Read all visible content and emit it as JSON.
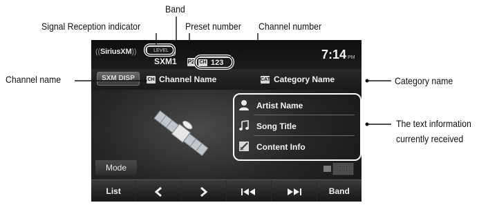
{
  "callouts": {
    "band": "Band",
    "signal_reception": "Signal Reception indicator",
    "preset_number": "Preset number",
    "channel_number": "Channel number",
    "channel_name": "Channel name",
    "category_name": "Category name",
    "text_info_line1": "The text information",
    "text_info_line2": "currently received"
  },
  "screen": {
    "logo": "SiriusXM",
    "level_indicator": "LEVEL",
    "band": "SXM1",
    "preset": "P2",
    "channel_tag": "CH",
    "channel_number": "123",
    "clock": "7:14",
    "clock_suffix": "PM",
    "disp_button": "SXM DISP",
    "channel_name": "Channel Name",
    "category_tag": "CAT",
    "category_name": "Category Name",
    "artist_name": "Artist Name",
    "song_title": "Song Title",
    "content_info": "Content Info",
    "mode_button": "Mode",
    "bottom": {
      "list": "List",
      "band": "Band"
    }
  }
}
